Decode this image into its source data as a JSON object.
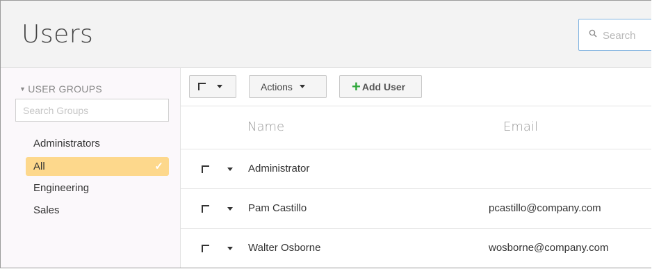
{
  "header": {
    "title": "Users",
    "search_placeholder": "Search",
    "search_icon": "search-icon"
  },
  "sidebar": {
    "section_label": "USER GROUPS",
    "group_search_placeholder": "Search Groups",
    "groups": [
      {
        "label": "Administrators",
        "selected": false
      },
      {
        "label": "All",
        "selected": true
      },
      {
        "label": "Engineering",
        "selected": false
      },
      {
        "label": "Sales",
        "selected": false
      }
    ],
    "selected_color": "#fdd88c"
  },
  "toolbar": {
    "actions_label": "Actions",
    "add_user_label": "Add User",
    "add_icon_color": "#2fa83b"
  },
  "table": {
    "columns": [
      "Name",
      "Email"
    ],
    "rows": [
      {
        "name": "Administrator",
        "email": ""
      },
      {
        "name": "Pam Castillo",
        "email": "pcastillo@company.com"
      },
      {
        "name": "Walter Osborne",
        "email": "wosborne@company.com"
      }
    ]
  }
}
